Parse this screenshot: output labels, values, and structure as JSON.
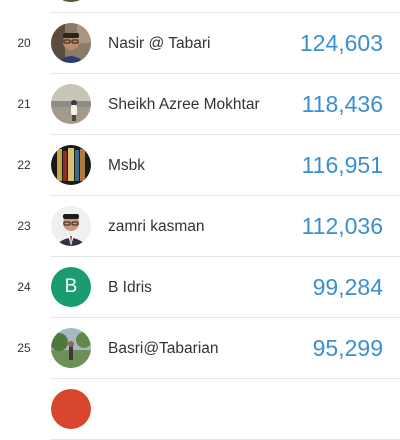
{
  "accent_color": "#3a8fd0",
  "leaderboard": [
    {
      "rank": "",
      "name": "",
      "score": "",
      "avatar": {
        "type": "photo",
        "icon": "avatar-photo-cutoff-icon",
        "colors": [
          "#4f5a3c",
          "#8c9570"
        ]
      }
    },
    {
      "rank": "20",
      "name": "Nasir @ Tabari",
      "score": "124,603",
      "avatar": {
        "type": "photo",
        "icon": "avatar-photo-man-glasses-icon",
        "colors": [
          "#7a6a5a",
          "#2c3e70"
        ]
      }
    },
    {
      "rank": "21",
      "name": "Sheikh Azree Mokhtar",
      "score": "118,436",
      "avatar": {
        "type": "photo",
        "icon": "avatar-photo-beach-icon",
        "colors": [
          "#b7b2a8",
          "#6d6e6c"
        ]
      }
    },
    {
      "rank": "22",
      "name": "Msbk",
      "score": "116,951",
      "avatar": {
        "type": "photo",
        "icon": "avatar-photo-books-icon",
        "colors": [
          "#1a1a1a",
          "#c9a24a"
        ]
      }
    },
    {
      "rank": "23",
      "name": "zamri kasman",
      "score": "112,036",
      "avatar": {
        "type": "photo",
        "icon": "avatar-photo-man-suit-icon",
        "colors": [
          "#eeeeee",
          "#2f3540"
        ]
      }
    },
    {
      "rank": "24",
      "name": "B Idris",
      "score": "99,284",
      "avatar": {
        "type": "letter",
        "letter": "B",
        "icon": "avatar-letter-icon",
        "colors": [
          "#1a9b72",
          "#1a9b72"
        ]
      }
    },
    {
      "rank": "25",
      "name": "Basri@Tabarian",
      "score": "95,299",
      "avatar": {
        "type": "photo",
        "icon": "avatar-photo-outdoor-icon",
        "colors": [
          "#5f8a4a",
          "#a9b7c4"
        ]
      }
    },
    {
      "rank": "",
      "name": "",
      "score": "",
      "avatar": {
        "type": "letter",
        "letter": "",
        "icon": "avatar-partial-icon",
        "colors": [
          "#d9462e",
          "#d9462e"
        ]
      }
    }
  ]
}
